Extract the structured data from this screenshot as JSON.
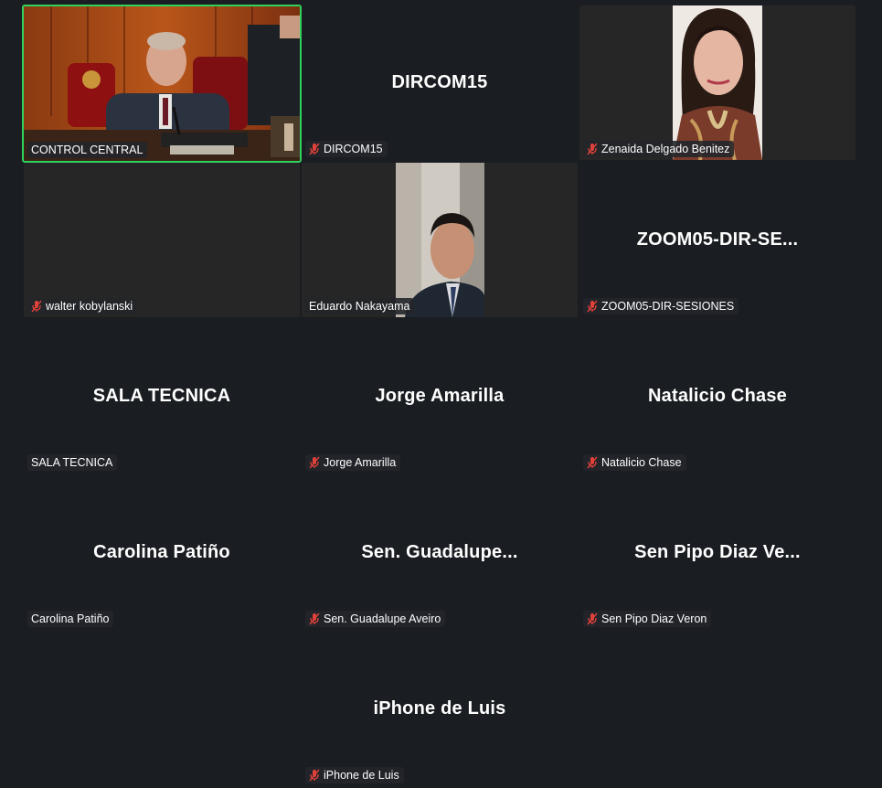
{
  "participants": [
    {
      "label": "CONTROL CENTRAL",
      "big_name": "",
      "muted": false,
      "video": true
    },
    {
      "label": "DIRCOM15",
      "big_name": "DIRCOM15",
      "muted": true,
      "video": false
    },
    {
      "label": "Zenaida Delgado Benitez",
      "big_name": "",
      "muted": true,
      "video": true
    },
    {
      "label": "walter kobylanski",
      "big_name": "",
      "muted": true,
      "video": false
    },
    {
      "label": "Eduardo Nakayama",
      "big_name": "",
      "muted": false,
      "video": true
    },
    {
      "label": "ZOOM05-DIR-SESIONES",
      "big_name": "ZOOM05-DIR-SE...",
      "muted": true,
      "video": false
    },
    {
      "label": "SALA TECNICA",
      "big_name": "SALA TECNICA",
      "muted": false,
      "video": false
    },
    {
      "label": "Jorge Amarilla",
      "big_name": "Jorge Amarilla",
      "muted": true,
      "video": false
    },
    {
      "label": "Natalicio Chase",
      "big_name": "Natalicio Chase",
      "muted": true,
      "video": false
    },
    {
      "label": "Carolina Patiño",
      "big_name": "Carolina Patiño",
      "muted": false,
      "video": false
    },
    {
      "label": "Sen. Guadalupe Aveiro",
      "big_name": "Sen.  Guadalupe...",
      "muted": true,
      "video": false
    },
    {
      "label": "Sen Pipo Diaz Veron",
      "big_name": "Sen Pipo Diaz Ve...",
      "muted": true,
      "video": false
    },
    {
      "label": "iPhone de Luis",
      "big_name": "iPhone de Luis",
      "muted": true,
      "video": false
    }
  ],
  "icons": {
    "muted": "mic-off-icon"
  },
  "colors": {
    "background": "#1a1d21",
    "active_speaker_border": "#2fd35c",
    "muted_icon": "#e0413a",
    "label_text": "#ffffff"
  }
}
